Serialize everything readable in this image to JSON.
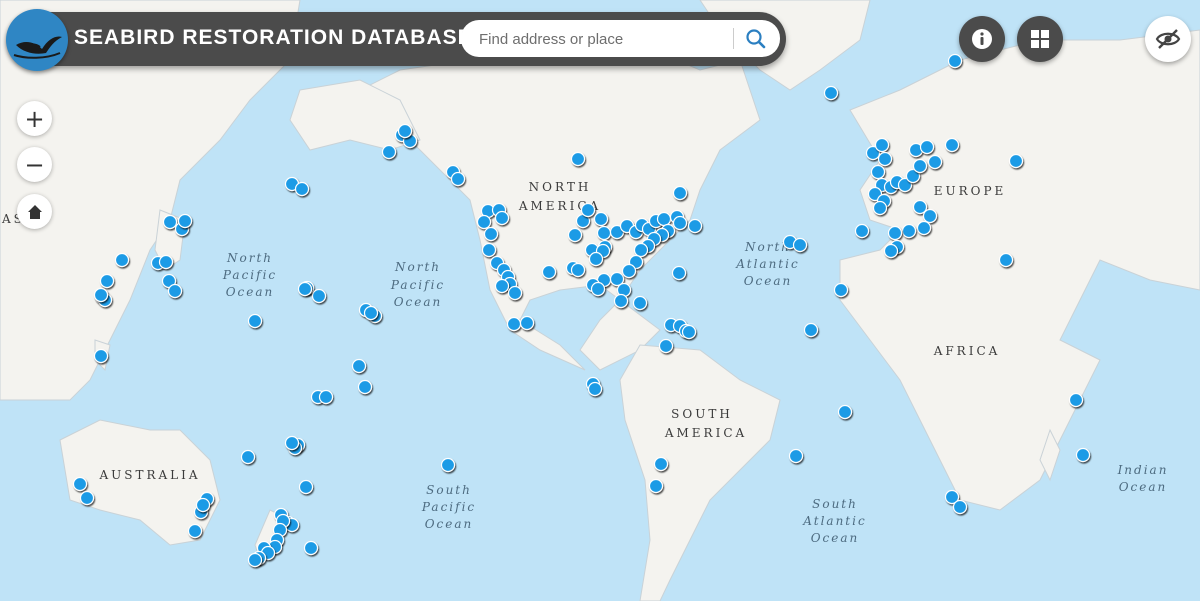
{
  "app": {
    "title": "SEABIRD RESTORATION DATABASE"
  },
  "search": {
    "placeholder": "Find address or place",
    "icon": "search-icon"
  },
  "controls": {
    "info": {
      "icon": "info-icon"
    },
    "basemap": {
      "icon": "grid-icon"
    },
    "visibility": {
      "icon": "eye-off-icon"
    },
    "zoom_in": "+",
    "zoom_out": "−",
    "home": {
      "icon": "home-icon"
    }
  },
  "map_labels": {
    "north_america": [
      "NORTH",
      "AMERICA"
    ],
    "south_america": [
      "SOUTH",
      "AMERICA"
    ],
    "europe": "EUROPE",
    "africa": "AFRICA",
    "australia": "AUSTRALIA",
    "asia_fragment": "AS",
    "north_pacific_west": [
      "North",
      "Pacific",
      "Ocean"
    ],
    "north_pacific_east": [
      "North",
      "Pacific",
      "Ocean"
    ],
    "north_atlantic": [
      "North",
      "Atlantic",
      "Ocean"
    ],
    "south_pacific": [
      "South",
      "Pacific",
      "Ocean"
    ],
    "south_atlantic": [
      "South",
      "Atlantic",
      "Ocean"
    ],
    "indian": [
      "Indian",
      "Ocean"
    ]
  },
  "colors": {
    "marker": "#1a9be6",
    "ocean": "#bfe3f7",
    "land": "#f4f3ef",
    "header": "#4b4b4b",
    "logo": "#2f86c4"
  }
}
